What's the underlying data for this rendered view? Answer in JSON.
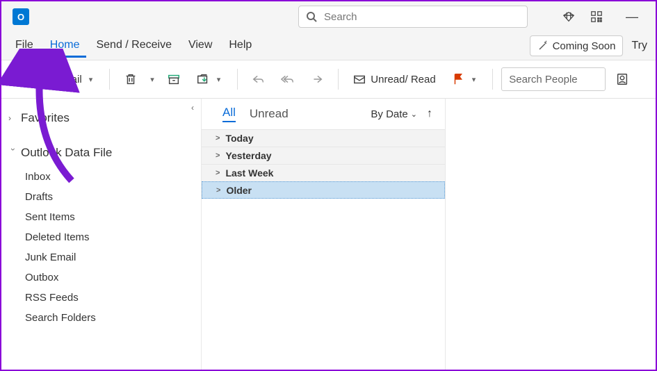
{
  "app_icon_letter": "O",
  "search": {
    "placeholder": "Search"
  },
  "menu": {
    "items": [
      "File",
      "Home",
      "Send / Receive",
      "View",
      "Help"
    ],
    "active_index": 1,
    "coming_soon": "Coming Soon",
    "try": "Try"
  },
  "ribbon": {
    "new_email": "New Email",
    "unread_read": "Unread/ Read",
    "search_people_placeholder": "Search People"
  },
  "nav": {
    "favorites": "Favorites",
    "data_file": "Outlook Data File",
    "folders": [
      "Inbox",
      "Drafts",
      "Sent Items",
      "Deleted Items",
      "Junk Email",
      "Outbox",
      "RSS Feeds",
      "Search Folders"
    ]
  },
  "list": {
    "tab_all": "All",
    "tab_unread": "Unread",
    "sort": "By Date",
    "groups": [
      "Today",
      "Yesterday",
      "Last Week",
      "Older"
    ],
    "selected_group_index": 3
  }
}
